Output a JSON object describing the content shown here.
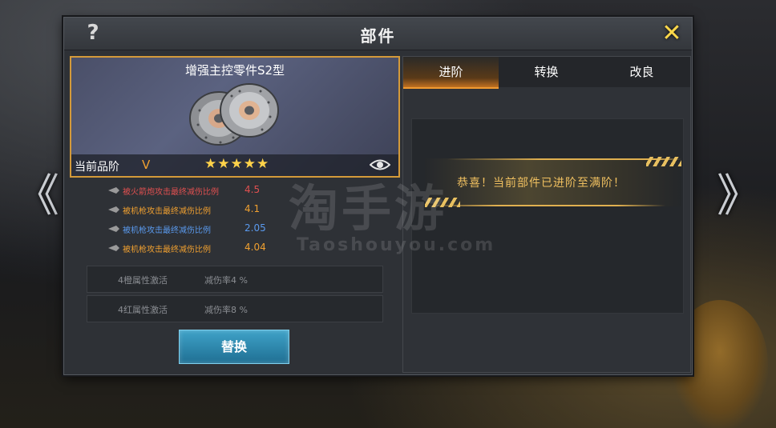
{
  "window": {
    "title": "部件",
    "help_glyph": "?",
    "close_glyph": "✕"
  },
  "part": {
    "name": "增强主控零件S2型",
    "quality_label": "当前品阶",
    "quality_value": "V",
    "stars": "★★★★★",
    "star_rating": 5,
    "image_icon": "brake-disc-icon",
    "view_icon": "eye-icon"
  },
  "stats": [
    {
      "label": "被火箭炮攻击最终减伤比例",
      "value": "4.5",
      "color": "#e05050"
    },
    {
      "label": "被机枪攻击最终减伤比例",
      "value": "4.1",
      "color": "#f0a030"
    },
    {
      "label": "被机枪攻击最终减伤比例",
      "value": "2.05",
      "color": "#5a9aee"
    },
    {
      "label": "被机枪攻击最终减伤比例",
      "value": "4.04",
      "color": "#f0a030"
    }
  ],
  "sets": [
    {
      "name": "4橙属性激活",
      "effect": "减伤率4 %"
    },
    {
      "name": "4红属性激活",
      "effect": "减伤率8 %"
    }
  ],
  "replace_button": "替换",
  "tabs": [
    {
      "label": "进阶",
      "active": true
    },
    {
      "label": "转换",
      "active": false
    },
    {
      "label": "改良",
      "active": false
    }
  ],
  "notice": "恭喜！当前部件已进阶至满阶！",
  "nav": {
    "left_glyph": "《",
    "right_glyph": "》"
  },
  "watermark": {
    "cn": "淘手游",
    "en": "Taoshouyou.com"
  },
  "colors": {
    "accent_gold": "#d49a3a",
    "tab_active": "#f09a30",
    "button_blue": "#2f8ab0"
  }
}
